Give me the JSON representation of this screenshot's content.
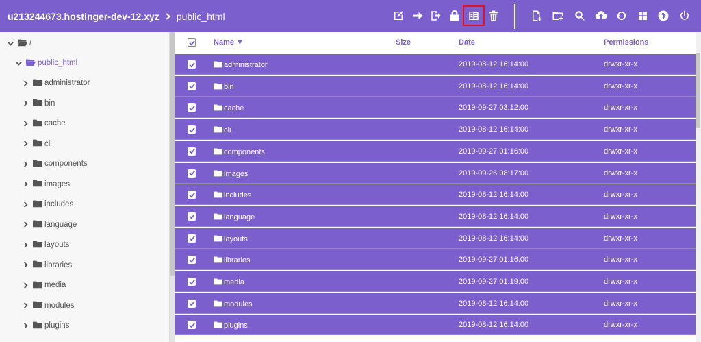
{
  "header": {
    "host": "u213244673.hostinger-dev-12.xyz",
    "current_dir": "public_html",
    "tools": [
      "edit-icon",
      "arrow-right-icon",
      "move-icon",
      "lock-icon",
      "archive-icon",
      "trash-icon",
      "new-file-icon",
      "new-folder-icon",
      "search-icon",
      "upload-icon",
      "refresh-icon",
      "grid-view-icon",
      "globe-icon",
      "power-icon"
    ]
  },
  "sidebar": {
    "root_label": "/",
    "open_folder": "public_html",
    "items": [
      "administrator",
      "bin",
      "cache",
      "cli",
      "components",
      "images",
      "includes",
      "language",
      "layouts",
      "libraries",
      "media",
      "modules",
      "plugins"
    ]
  },
  "table": {
    "headers": {
      "name": "Name ▼",
      "size": "Size",
      "date": "Date",
      "permissions": "Permissions"
    },
    "rows": [
      {
        "name": "administrator",
        "date": "2019-08-12 16:14:00",
        "perm": "drwxr-xr-x"
      },
      {
        "name": "bin",
        "date": "2019-08-12 16:14:00",
        "perm": "drwxr-xr-x"
      },
      {
        "name": "cache",
        "date": "2019-09-27 03:12:00",
        "perm": "drwxr-xr-x"
      },
      {
        "name": "cli",
        "date": "2019-08-12 16:14:00",
        "perm": "drwxr-xr-x"
      },
      {
        "name": "components",
        "date": "2019-09-27 01:16:00",
        "perm": "drwxr-xr-x"
      },
      {
        "name": "images",
        "date": "2019-09-26 08:17:00",
        "perm": "drwxr-xr-x"
      },
      {
        "name": "includes",
        "date": "2019-08-12 16:14:00",
        "perm": "drwxr-xr-x"
      },
      {
        "name": "language",
        "date": "2019-08-12 16:14:00",
        "perm": "drwxr-xr-x"
      },
      {
        "name": "layouts",
        "date": "2019-08-12 16:14:00",
        "perm": "drwxr-xr-x"
      },
      {
        "name": "libraries",
        "date": "2019-09-27 01:16:00",
        "perm": "drwxr-xr-x"
      },
      {
        "name": "media",
        "date": "2019-09-27 01:19:00",
        "perm": "drwxr-xr-x"
      },
      {
        "name": "modules",
        "date": "2019-08-12 16:14:00",
        "perm": "drwxr-xr-x"
      },
      {
        "name": "plugins",
        "date": "2019-08-12 16:14:00",
        "perm": "drwxr-xr-x"
      }
    ]
  },
  "colors": {
    "accent": "#7b5fcd",
    "highlight": "#e0141e"
  }
}
